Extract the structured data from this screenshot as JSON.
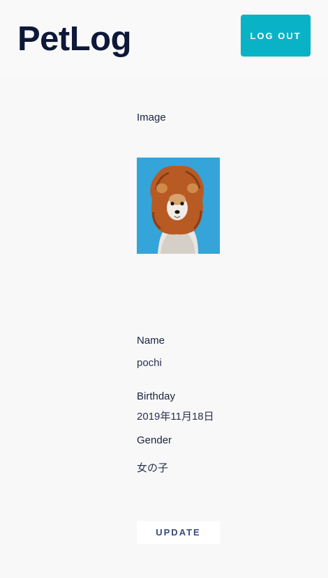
{
  "header": {
    "app_title": "PetLog",
    "logout_label": "LOG OUT",
    "accent_color": "#0ab2c6"
  },
  "pet": {
    "image_label": "Image",
    "image_icon": "dog-photo",
    "name_label": "Name",
    "name_value": "pochi",
    "birthday_label": "Birthday",
    "birthday_value": "2019年11月18日",
    "gender_label": "Gender",
    "gender_value": "女の子"
  },
  "actions": {
    "update_label": "UPDATE"
  }
}
